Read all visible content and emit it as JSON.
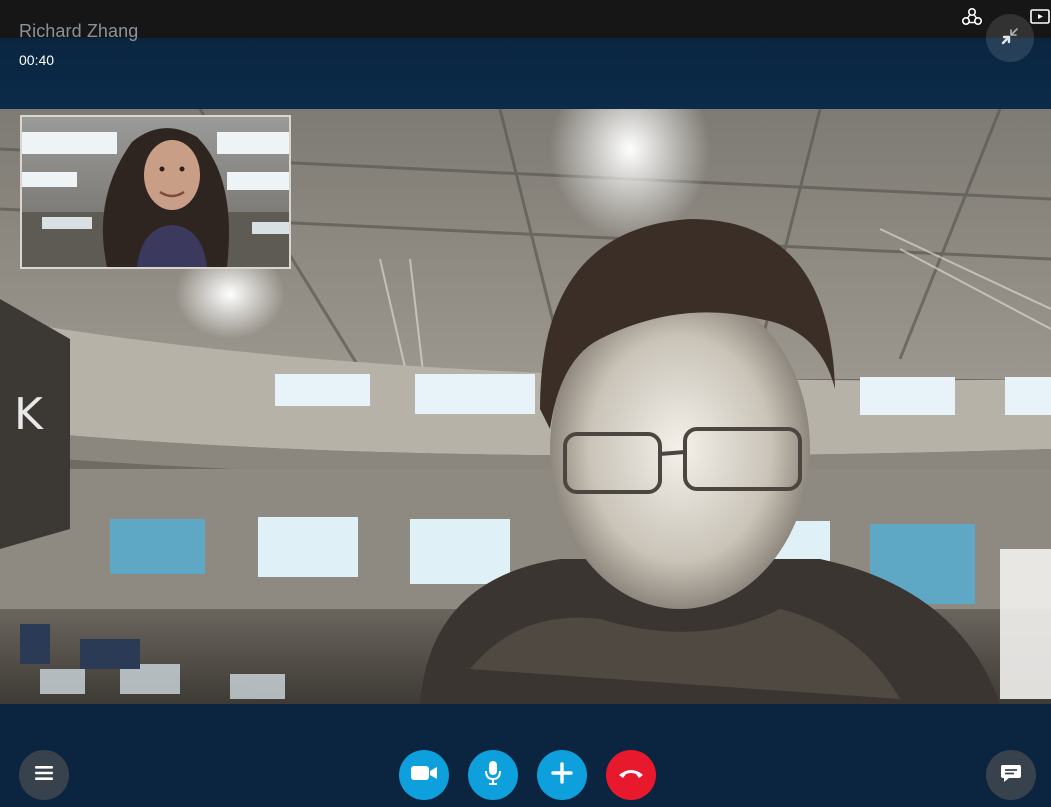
{
  "call": {
    "caller_name": "Richard Zhang",
    "timer": "00:40"
  },
  "icons": {
    "top_right": [
      "contacts-icon",
      "picture-in-picture-icon"
    ],
    "collapse": "collapse-arrows-icon"
  },
  "controls": {
    "menu": "menu-icon",
    "video": "video-camera-icon",
    "microphone": "microphone-icon",
    "add": "plus-icon",
    "hangup": "hang-up-icon",
    "chat": "chat-bubble-icon"
  },
  "colors": {
    "accent_blue": "#0ea0dd",
    "hangup_red": "#e8192c",
    "bar_background": "#0b2540"
  }
}
